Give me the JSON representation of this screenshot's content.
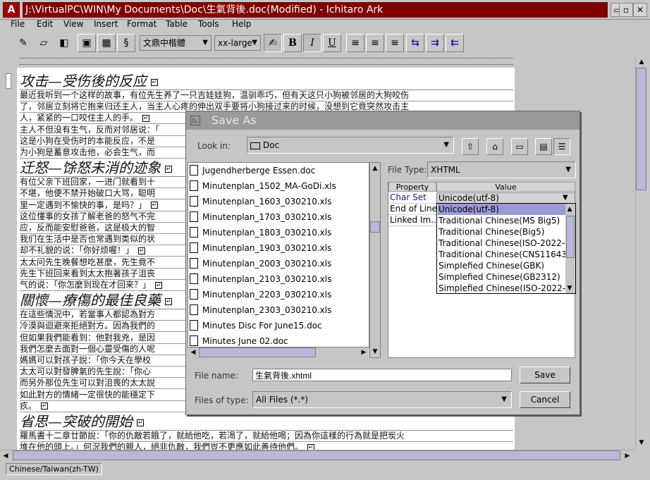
{
  "window": {
    "icon_letter": "A",
    "title": "J:\\VirtualPC\\WIN\\My Documents\\Doc\\生氣背後.doc(Modified) - Ichitaro Ark",
    "minimize_glyph": "▭",
    "maximize_glyph": "▫",
    "close_glyph": "✕"
  },
  "menu": [
    "File",
    "Edit",
    "View",
    "Insert",
    "Format",
    "Table",
    "Tools",
    "Help"
  ],
  "toolbar": {
    "new_icon": "✎",
    "open_icon": "▱",
    "save_icon": "◧",
    "frame_icon": "▣",
    "table_icon": "▦",
    "link_icon": "§",
    "font_name": "文鼎中楷體",
    "font_size": "xx-large",
    "style_icon": "✍",
    "bold": "B",
    "italic": "I",
    "underline": "U",
    "align_left": "≡",
    "align_center": "≡",
    "align_right": "≡",
    "indent_a": "⇆",
    "indent_b": "⇉",
    "indent_c": "⇇",
    "arrow": "▼"
  },
  "document": {
    "lines": [
      {
        "kind": "h",
        "text": "攻击—受伤後的反应"
      },
      {
        "kind": "b",
        "text": "最近我听到一个这样的故事，有位先生养了一只吉娃娃狗，温驯乖巧，但有天这只小狗被邻居的大狗咬伤"
      },
      {
        "kind": "b",
        "text": "了，邻居立刻将它抱来归还主人，当主人心疼的伸出双手要将小狗接过来的时候，没想到它竟突然攻击主"
      },
      {
        "kind": "b",
        "text": "人，紧紧的一口咬住主人的手。"
      },
      {
        "kind": "b",
        "text": "主人不但没有生气，反而对邻居说：「"
      },
      {
        "kind": "b",
        "text": "这是小狗在受伤时的本能反应，不是"
      },
      {
        "kind": "b",
        "text": "为小狗是蓄意攻击他，必会生气，而"
      },
      {
        "kind": "h",
        "text": "迁怒—馀怒未消的迹象"
      },
      {
        "kind": "b",
        "text": "有位父亲下班回家，一进门就看到十"
      },
      {
        "kind": "b",
        "text": "不堪，他便不禁开始破口大骂，聪明"
      },
      {
        "kind": "b",
        "text": "里一定遇到不愉快的事，是吗？」"
      },
      {
        "kind": "b",
        "text": "这位懂事的女孩了解老爸的怒气不完"
      },
      {
        "kind": "b",
        "text": "应，反而能安慰爸爸，这是极大的智"
      },
      {
        "kind": "b",
        "text": "我们在生活中是否也常遇到类似的状"
      },
      {
        "kind": "b",
        "text": "却不礼貌的说：「你好烦喔！」"
      },
      {
        "kind": "b",
        "text": "太太问先生晚餐想吃甚麼，先生竟不"
      },
      {
        "kind": "b",
        "text": "先生下班回来看到太太抱著孩子沮丧"
      },
      {
        "kind": "b",
        "text": "气的说：「你怎麼到现在才回来？」"
      },
      {
        "kind": "h",
        "text": "關懷—療傷的最佳良藥"
      },
      {
        "kind": "b",
        "text": "在這些情況中，若當事人都認為對方"
      },
      {
        "kind": "b",
        "text": "冷漠與迴避來拒絕對方。因為我們的"
      },
      {
        "kind": "b",
        "text": "但如果我們能看到：他對我兇，是因"
      },
      {
        "kind": "b",
        "text": "我們怎麼去面對一個心靈受傷的人呢"
      },
      {
        "kind": "b",
        "text": "媽媽可以對孩子說：「你今天在學校"
      },
      {
        "kind": "b",
        "text": "太太可以對發脾氣的先生說：「你心"
      },
      {
        "kind": "b",
        "text": "而另外那位先生可以對沮喪的太太說"
      },
      {
        "kind": "b",
        "text": "如此對方的情緒一定很快的能穩定下"
      },
      {
        "kind": "b",
        "text": "疚。"
      },
      {
        "kind": "h",
        "text": "省思—突破的開始"
      },
      {
        "kind": "b",
        "text": "羅馬書十二章廿節說：「你的仇敵若餓了，就給他吃，若渴了，就給他喝；因為你這樣的行為就是把炭火"
      },
      {
        "kind": "b",
        "text": "堆在他的頭上。」何況我們的親人，絕非仇敵，我們豈不更應如此善待他們。"
      }
    ]
  },
  "statusbar": {
    "locale": "Chinese/Taiwan(zh-TW)"
  },
  "dialog": {
    "title": "Save As",
    "look_in_label": "Look in:",
    "look_in_value": "Doc",
    "up_icon": "⇧",
    "home_icon": "⌂",
    "newfolder_icon": "▭",
    "list_icon": "▤",
    "details_icon": "☰",
    "files": [
      "Jugendherberge Essen.doc",
      "Minutenplan_1502_MA-GoDi.xls",
      "Minutenplan_1603_030210.xls",
      "Minutenplan_1703_030210.xls",
      "Minutenplan_1803_030210.xls",
      "Minutenplan_1903_030210.xls",
      "Minutenplan_2003_030210.xls",
      "Minutenplan_2103_030210.xls",
      "Minutenplan_2203_030210.xls",
      "Minutenplan_2303_030210.xls",
      "Minutes Disc For June15.doc",
      "Minutes June 02.doc"
    ],
    "file_type_label": "File Type:",
    "file_type_value": "XHTML",
    "prop_header_property": "Property",
    "prop_header_value": "Value",
    "properties": [
      {
        "name": "Char Set",
        "value": "Unicode(utf-8)"
      },
      {
        "name": "End of Line",
        "value": ""
      },
      {
        "name": "Linked Im...",
        "value": ""
      }
    ],
    "charset_options": [
      "Unicode(utf-8)",
      "Traditional Chinese(MS Big5)",
      "Traditional Chinese(Big5)",
      "Traditional Chinese(ISO-2022-CN",
      "Traditional Chinese(CNS11643)",
      "Simplefied Chinese(GBK)",
      "Simplefied Chinese(GB2312)",
      "Simplefied Chinese(ISO-2022-CN"
    ],
    "charset_selected_index": 0,
    "file_name_label": "File name:",
    "file_name_value": "生氣背後.xhtml",
    "files_of_type_label": "Files of type:",
    "files_of_type_value": "All Files (*.*)",
    "save_button": "Save",
    "cancel_button": "Cancel"
  }
}
